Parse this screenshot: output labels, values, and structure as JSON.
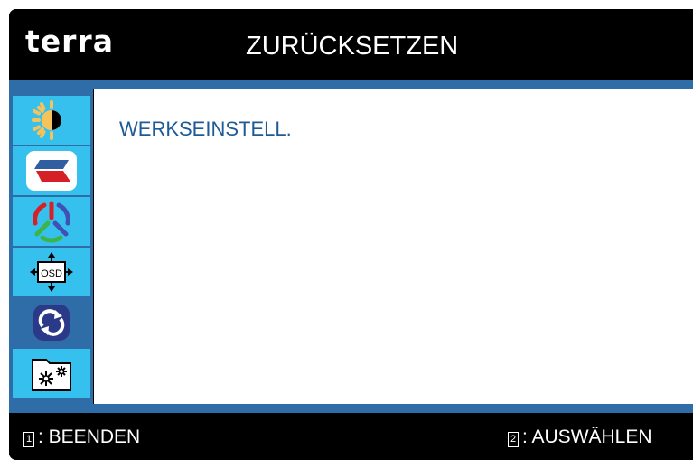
{
  "header": {
    "logo": "terra",
    "title": "ZURÜCKSETZEN"
  },
  "sidebar": {
    "items": [
      {
        "icon": "brightness-contrast-icon",
        "selected": false
      },
      {
        "icon": "image-position-icon",
        "selected": false
      },
      {
        "icon": "color-icon",
        "selected": false
      },
      {
        "icon": "osd-settings-icon",
        "selected": false
      },
      {
        "icon": "reset-icon",
        "selected": true
      },
      {
        "icon": "extra-settings-icon",
        "selected": false
      }
    ]
  },
  "content": {
    "items": [
      "WERKSEINSTELL."
    ]
  },
  "footer": {
    "left_key": "1",
    "left_label": ": BEENDEN",
    "right_key": "2",
    "right_label": ": AUSWÄHLEN"
  },
  "colors": {
    "accent": "#2f6da8",
    "item_bg": "#36c0ee",
    "text_blue": "#1e5b96",
    "frame": "#000000"
  }
}
